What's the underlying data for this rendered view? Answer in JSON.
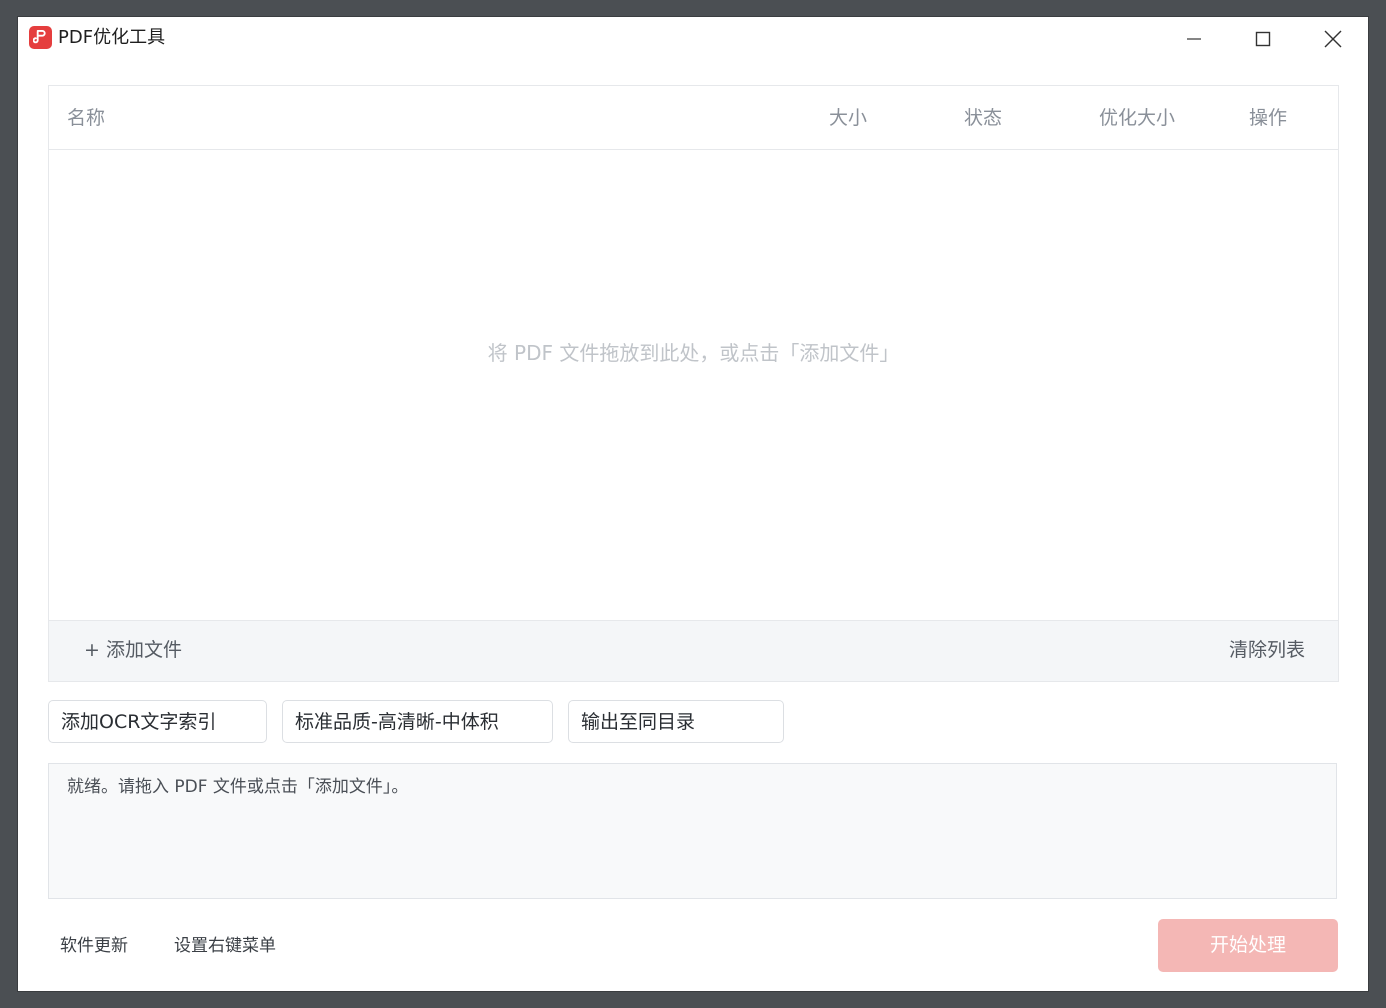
{
  "window": {
    "title": "PDF优化工具"
  },
  "table": {
    "columns": {
      "name": "名称",
      "size": "大小",
      "status": "状态",
      "optimized_size": "优化大小",
      "action": "操作"
    },
    "rows": [],
    "empty_hint": "将 PDF 文件拖放到此处，或点击「添加文件」"
  },
  "panel_footer": {
    "add_file": "+ 添加文件",
    "clear_list": "清除列表"
  },
  "options": {
    "ocr": "添加OCR文字索引",
    "quality": "标准品质-高清晰-中体积",
    "output": "输出至同目录"
  },
  "log": {
    "text": "就绪。请拖入 PDF 文件或点击「添加文件」。"
  },
  "bottom": {
    "update": "软件更新",
    "context_menu": "设置右键菜单",
    "start": "开始处理"
  },
  "colors": {
    "accent": "#e53e3e",
    "start_button_disabled": "#f4b7b5",
    "window_frame": "#4b4f53"
  },
  "icons": {
    "app": "pdf-app-icon",
    "minimize": "minimize-icon",
    "maximize": "maximize-icon",
    "close": "close-icon"
  }
}
